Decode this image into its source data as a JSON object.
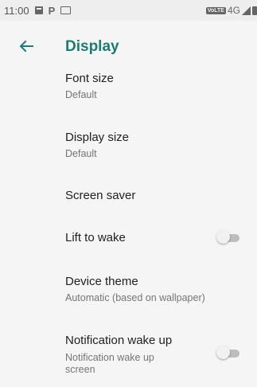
{
  "status_bar": {
    "time": "11:00",
    "volte": "VoLTE",
    "network": "4G"
  },
  "app_bar": {
    "title": "Display",
    "accent_color": "#1a7d72"
  },
  "settings": [
    {
      "title": "Font size",
      "subtitle": "Default"
    },
    {
      "title": "Display size",
      "subtitle": "Default"
    },
    {
      "title": "Screen saver"
    },
    {
      "title": "Lift to wake",
      "toggle_on": false
    },
    {
      "title": "Device theme",
      "subtitle": "Automatic (based on wallpaper)"
    },
    {
      "title": "Notification wake up",
      "subtitle": "Notification wake up screen",
      "toggle_on": false
    }
  ]
}
